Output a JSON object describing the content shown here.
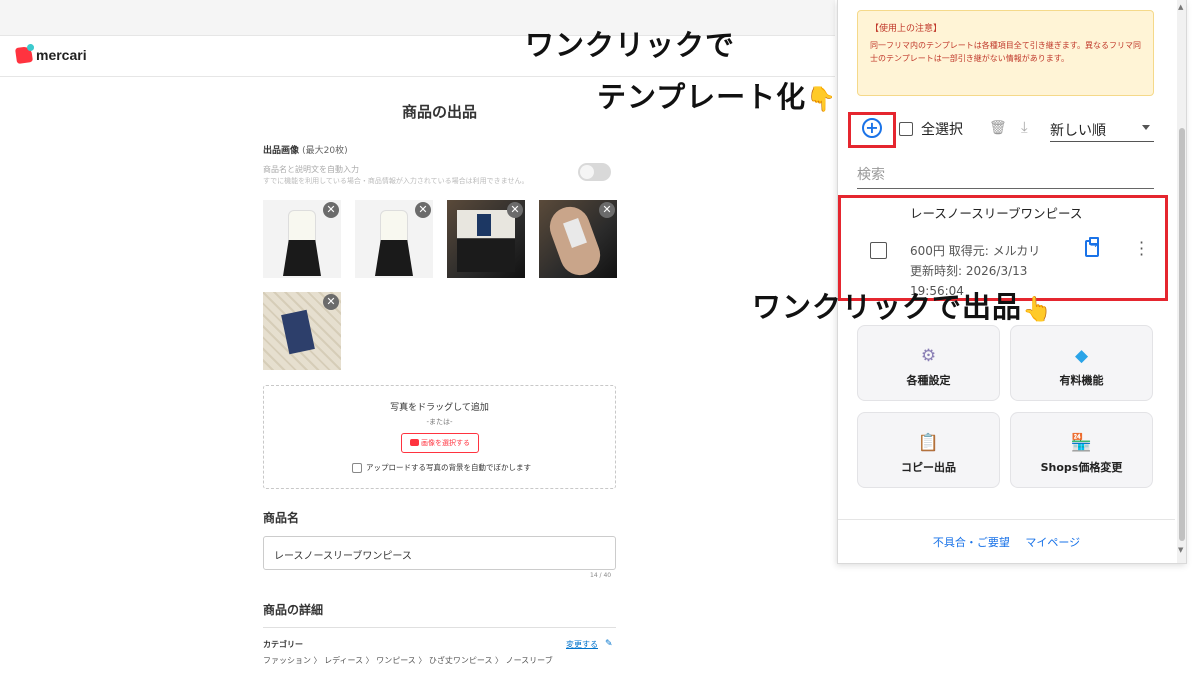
{
  "mercari": {
    "logo_text": "mercari",
    "page_title": "商品の出品",
    "images_label": "出品画像",
    "images_label_sub": "(最大20枚)",
    "auto_title": "商品名と説明文を自動入力",
    "auto_note": "すでに機能を利用している場合・商品情報が入力されている場合は利用できません。",
    "remove_glyph": "✕",
    "dropzone": {
      "text": "写真をドラッグして追加",
      "or": "-または-",
      "select_button": "画像を選択する",
      "blur_checkbox": "アップロードする写真の背景を自動でぼかします"
    },
    "name_section": "商品名",
    "name_value": "レースノースリーブワンピース",
    "name_counter": "14 / 40",
    "detail_section": "商品の詳細",
    "category_label": "カテゴリー",
    "category_change": "変更する",
    "breadcrumb": "ファッション 〉 レディース 〉 ワンピース 〉 ひざ丈ワンピース 〉 ノースリーブ"
  },
  "annotations": {
    "one_click_template_line1": "ワンクリックで",
    "one_click_template_line2": "テンプレート化",
    "one_click_listing": "ワンクリックで出品"
  },
  "panel": {
    "notice_title": "【使用上の注意】",
    "notice_body": "同一フリマ内のテンプレートは各種項目全て引き継ぎます。異なるフリマ同士のテンプレートは一部引き継がない情報があります。",
    "select_all": "全選択",
    "sort_value": "新しい順",
    "search_placeholder": "検索",
    "template": {
      "title": "レースノースリーブワンピース",
      "price_source": "600円 取得元: メルカリ",
      "updated_label": "更新時刻: 2026/3/13",
      "updated_time": "19:56:04"
    },
    "buttons": [
      {
        "label": "各種設定",
        "icon": "gear-icon"
      },
      {
        "label": "有料機能",
        "icon": "diamond-icon"
      },
      {
        "label": "コピー出品",
        "icon": "clipboard-icon"
      },
      {
        "label": "Shops価格変更",
        "icon": "shop-icon"
      }
    ],
    "footer": {
      "feedback": "不具合・ご要望",
      "mypage": "マイページ"
    }
  },
  "colors": {
    "mercari_red": "#ff333f",
    "accent_blue": "#1a73e8",
    "highlight_red": "#e5262f",
    "notice_bg": "#fff4d6"
  }
}
